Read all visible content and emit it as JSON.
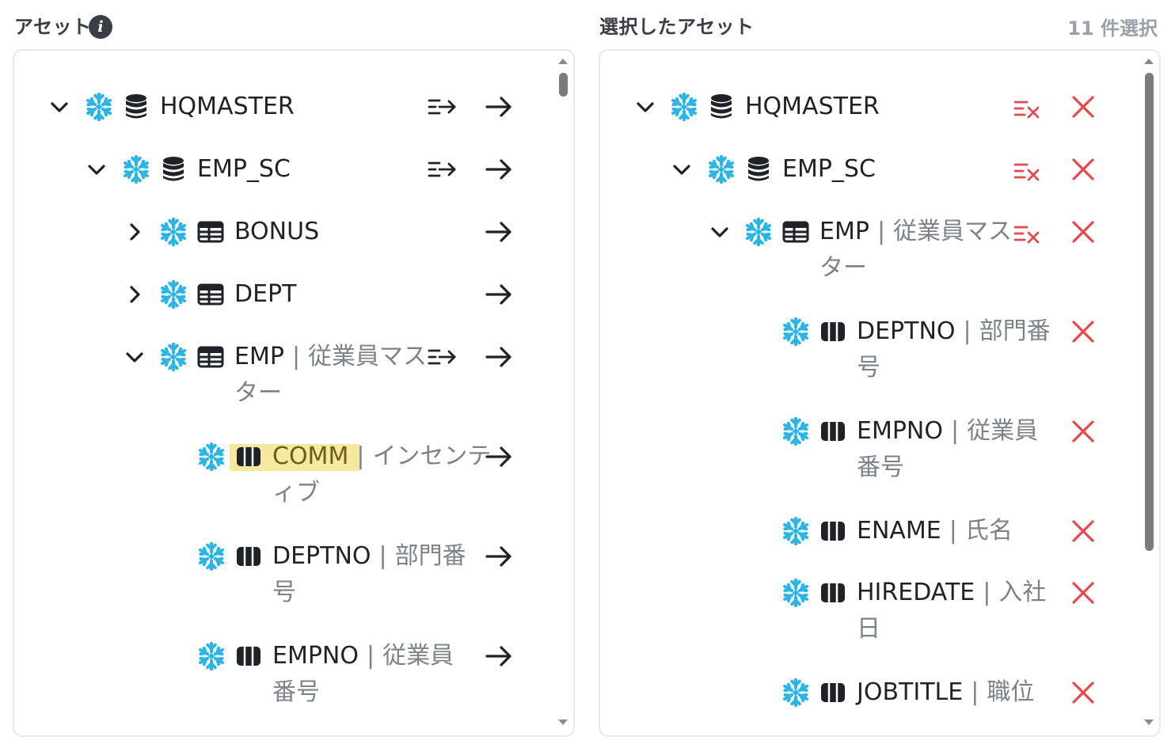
{
  "left_panel": {
    "title": "アセット",
    "info_icon": "info-icon",
    "rows": [
      {
        "name": "HQMASTER",
        "desc": ""
      },
      {
        "name": "EMP_SC",
        "desc": ""
      },
      {
        "name": "BONUS",
        "desc": ""
      },
      {
        "name": "DEPT",
        "desc": ""
      },
      {
        "name": "EMP",
        "desc": "従業員マス",
        "desc2": "ター"
      },
      {
        "name": "COMM",
        "desc": "インセンテ",
        "desc2": "ィブ"
      },
      {
        "name": "DEPTNO",
        "desc": "部門番",
        "desc2": "号"
      },
      {
        "name": "EMPNO",
        "desc": "従業員",
        "desc2": "番号"
      }
    ]
  },
  "right_panel": {
    "title": "選択したアセット",
    "count": "11 件選択",
    "rows": [
      {
        "name": "HQMASTER",
        "desc": ""
      },
      {
        "name": "EMP_SC",
        "desc": ""
      },
      {
        "name": "EMP",
        "desc": "従業員マス",
        "desc2": "ター"
      },
      {
        "name": "DEPTNO",
        "desc": "部門番",
        "desc2": "号"
      },
      {
        "name": "EMPNO",
        "desc": "従業員",
        "desc2": "番号"
      },
      {
        "name": "ENAME",
        "desc": "氏名"
      },
      {
        "name": "HIREDATE",
        "desc": "入社",
        "desc2": "日"
      },
      {
        "name": "JOBTITLE",
        "desc": "職位"
      }
    ]
  },
  "colors": {
    "snowflake": "#29b5e8",
    "remove": "#e5484d",
    "highlight": "#f7e8a0",
    "muted": "#7b8289"
  }
}
